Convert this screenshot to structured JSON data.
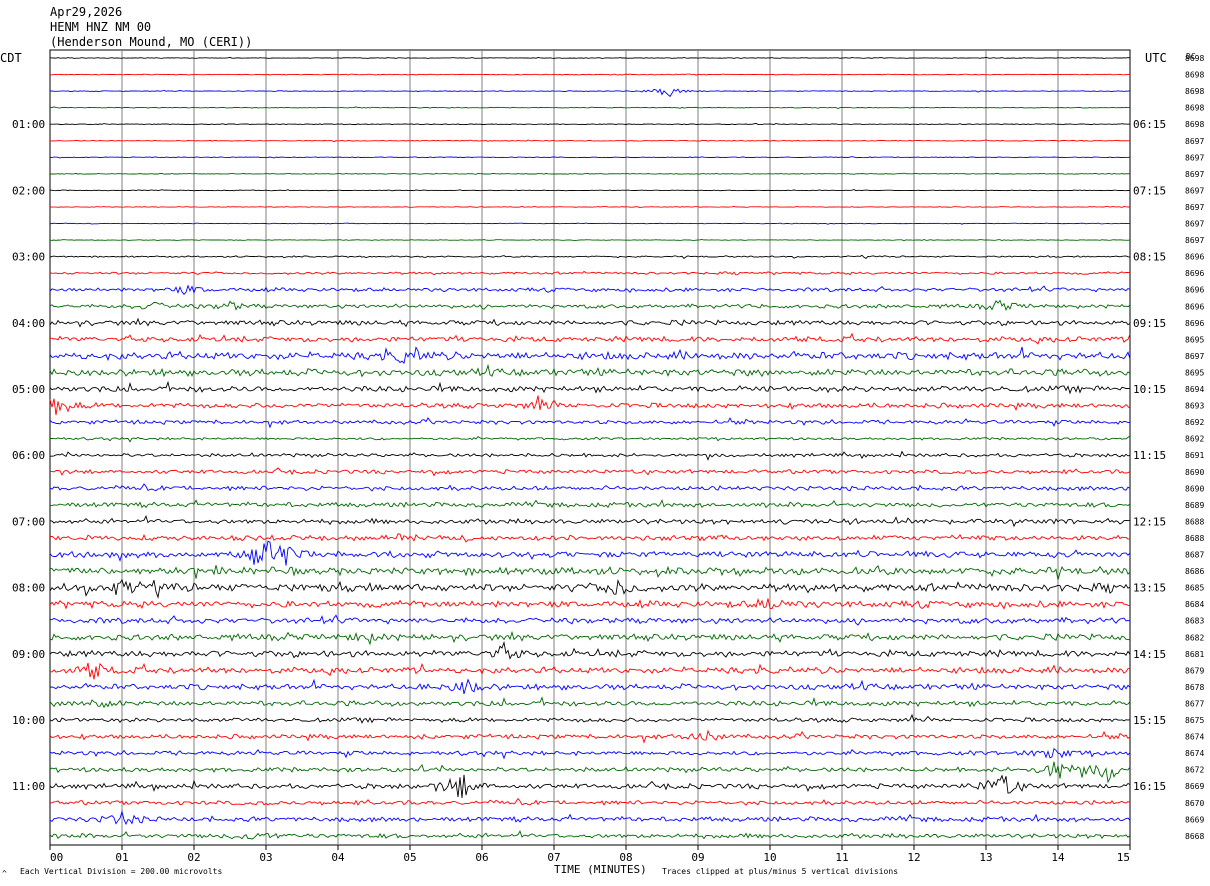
{
  "header": {
    "date": "Apr29,2026",
    "station": "HENM HNZ NM 00",
    "location": "(Henderson Mound, MO (CERI))"
  },
  "left_zone_label": "CDT",
  "right_zone_label": "UTC",
  "dc_label": "DC",
  "footer": {
    "scale_note": "Each Vertical Division =  200.00 microvolts",
    "xlabel": "TIME (MINUTES)",
    "clip_note": "Traces clipped at plus/minus 5 vertical divisions",
    "corner_mark": "^"
  },
  "colors": {
    "trace_cycle": [
      "#000000",
      "#ff0000",
      "#0000ff",
      "#006600"
    ],
    "grid": "#808080"
  },
  "chart_data": {
    "type": "helicorder",
    "title": "",
    "xlabel": "TIME (MINUTES)",
    "x_ticks": [
      "00",
      "01",
      "02",
      "03",
      "04",
      "05",
      "06",
      "07",
      "08",
      "09",
      "10",
      "11",
      "12",
      "13",
      "14",
      "15"
    ],
    "xlim": [
      0,
      15
    ],
    "rows": 48,
    "minutes_per_row": 15,
    "left_time_labels": [
      {
        "row": 4,
        "text": "01:00"
      },
      {
        "row": 8,
        "text": "02:00"
      },
      {
        "row": 12,
        "text": "03:00"
      },
      {
        "row": 16,
        "text": "04:00"
      },
      {
        "row": 20,
        "text": "05:00"
      },
      {
        "row": 24,
        "text": "06:00"
      },
      {
        "row": 28,
        "text": "07:00"
      },
      {
        "row": 32,
        "text": "08:00"
      },
      {
        "row": 36,
        "text": "09:00"
      },
      {
        "row": 40,
        "text": "10:00"
      },
      {
        "row": 44,
        "text": "11:00"
      }
    ],
    "right_time_labels": [
      {
        "row": 4,
        "text": "06:15"
      },
      {
        "row": 8,
        "text": "07:15"
      },
      {
        "row": 12,
        "text": "08:15"
      },
      {
        "row": 16,
        "text": "09:15"
      },
      {
        "row": 20,
        "text": "10:15"
      },
      {
        "row": 24,
        "text": "11:15"
      },
      {
        "row": 28,
        "text": "12:15"
      },
      {
        "row": 32,
        "text": "13:15"
      },
      {
        "row": 36,
        "text": "14:15"
      },
      {
        "row": 40,
        "text": "15:15"
      },
      {
        "row": 44,
        "text": "16:15"
      }
    ],
    "dc_offsets": [
      "8698",
      "8698",
      "8698",
      "8698",
      "8698",
      "8697",
      "8697",
      "8697",
      "8697",
      "8697",
      "8697",
      "8697",
      "8696",
      "8696",
      "8696",
      "8696",
      "8696",
      "8695",
      "8697",
      "8695",
      "8694",
      "8693",
      "8692",
      "8692",
      "8691",
      "8690",
      "8690",
      "8689",
      "8688",
      "8688",
      "8687",
      "8686",
      "8685",
      "8684",
      "8683",
      "8682",
      "8681",
      "8679",
      "8678",
      "8677",
      "8675",
      "8674",
      "8674",
      "8672",
      "8669",
      "8670",
      "8669",
      "8668"
    ],
    "noise_level": [
      0.3,
      0.35,
      0.3,
      0.3,
      0.3,
      0.3,
      0.3,
      0.3,
      0.3,
      0.3,
      0.3,
      0.3,
      0.6,
      1.0,
      1.5,
      1.6,
      2.0,
      2.2,
      3.0,
      2.8,
      2.4,
      2.0,
      1.6,
      1.0,
      1.4,
      1.6,
      1.8,
      1.9,
      2.0,
      2.1,
      2.4,
      3.0,
      3.2,
      2.6,
      2.3,
      2.5,
      2.6,
      2.5,
      2.3,
      2.1,
      1.7,
      1.8,
      1.7,
      1.8,
      2.0,
      1.7,
      1.9,
      1.8
    ],
    "events": [
      {
        "row": 2,
        "minute": 8.6,
        "amplitude": 6
      },
      {
        "row": 14,
        "minute": 1.9,
        "amplitude": 4
      },
      {
        "row": 15,
        "minute": 1.4,
        "amplitude": 4
      },
      {
        "row": 15,
        "minute": 2.5,
        "amplitude": 4
      },
      {
        "row": 15,
        "minute": 13.2,
        "amplitude": 5
      },
      {
        "row": 18,
        "minute": 5.0,
        "amplitude": 8
      },
      {
        "row": 21,
        "minute": 0.1,
        "amplitude": 10
      },
      {
        "row": 21,
        "minute": 6.8,
        "amplitude": 5
      },
      {
        "row": 30,
        "minute": 3.0,
        "amplitude": 16
      },
      {
        "row": 30,
        "minute": 3.3,
        "amplitude": 9
      },
      {
        "row": 32,
        "minute": 1.0,
        "amplitude": 8
      },
      {
        "row": 32,
        "minute": 7.9,
        "amplitude": 8
      },
      {
        "row": 33,
        "minute": 10.0,
        "amplitude": 6
      },
      {
        "row": 35,
        "minute": 4.4,
        "amplitude": 5
      },
      {
        "row": 36,
        "minute": 6.3,
        "amplitude": 7
      },
      {
        "row": 37,
        "minute": 0.6,
        "amplitude": 8
      },
      {
        "row": 38,
        "minute": 5.8,
        "amplitude": 7
      },
      {
        "row": 39,
        "minute": 0.6,
        "amplitude": 6
      },
      {
        "row": 41,
        "minute": 9.1,
        "amplitude": 6
      },
      {
        "row": 42,
        "minute": 13.9,
        "amplitude": 8
      },
      {
        "row": 43,
        "minute": 14.0,
        "amplitude": 12
      },
      {
        "row": 43,
        "minute": 14.7,
        "amplitude": 12
      },
      {
        "row": 44,
        "minute": 5.7,
        "amplitude": 14
      },
      {
        "row": 44,
        "minute": 13.2,
        "amplitude": 14
      },
      {
        "row": 46,
        "minute": 1.0,
        "amplitude": 7
      },
      {
        "row": 47,
        "minute": 2.8,
        "amplitude": 5
      }
    ]
  }
}
